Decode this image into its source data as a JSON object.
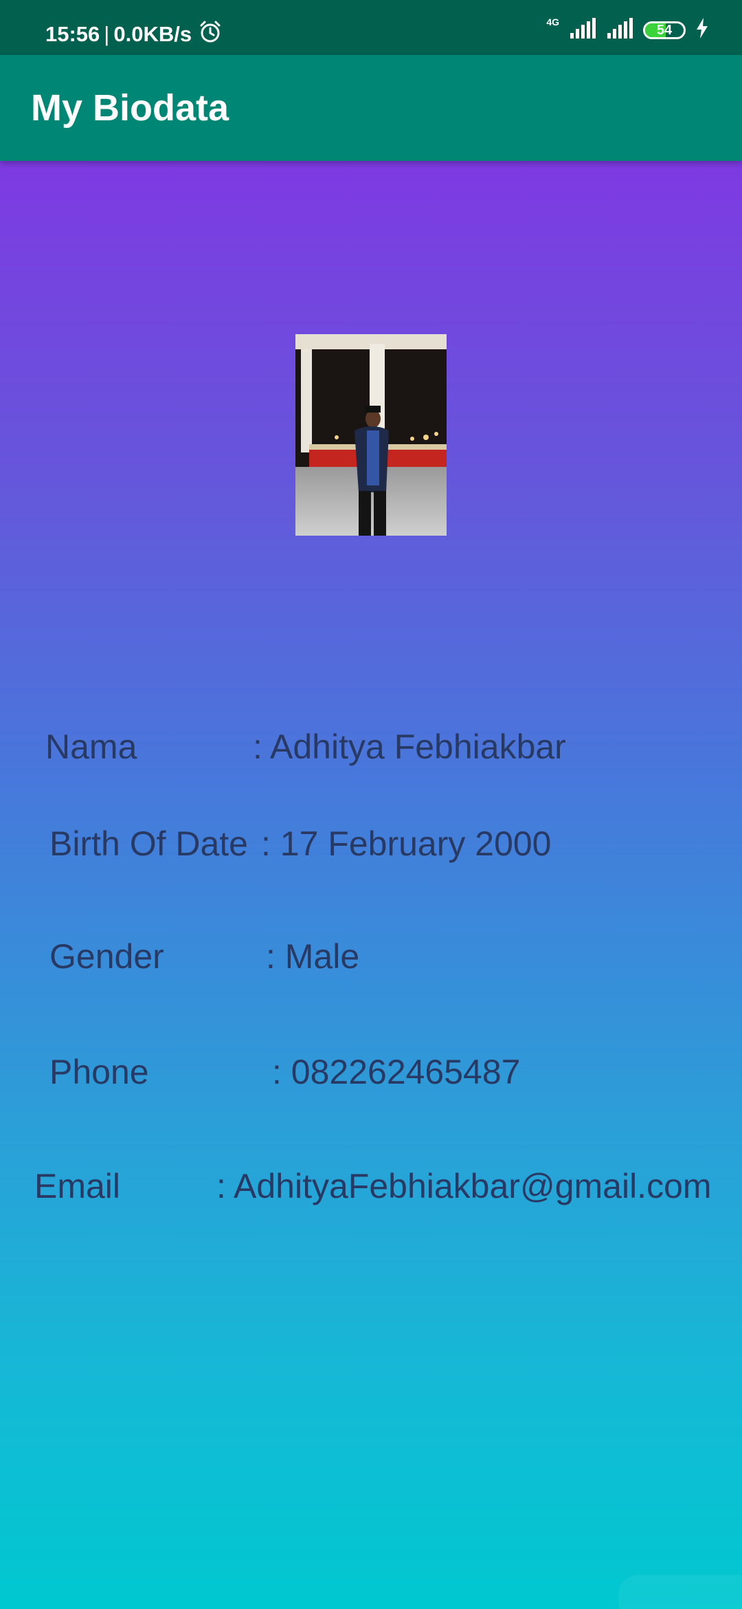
{
  "status_bar": {
    "time": "15:56",
    "separator": "|",
    "speed": "0.0KB/s",
    "network": "4G",
    "battery_level": "54",
    "battery_fraction": 0.54,
    "icons": [
      "alarm-icon",
      "signal-icon",
      "signal-icon",
      "battery-icon",
      "charging-icon"
    ]
  },
  "app_bar": {
    "title": "My Biodata"
  },
  "profile": {
    "photo_icon": "profile-photo"
  },
  "biodata": {
    "nama": {
      "label": "Nama",
      "value": ": Adhitya Febhiakbar"
    },
    "birth": {
      "label": "Birth Of Date",
      "value": ": 17 February 2000"
    },
    "gender": {
      "label": "Gender",
      "value": ": Male"
    },
    "phone": {
      "label": "Phone",
      "value": ": 082262465487"
    },
    "email": {
      "label": "Email",
      "value": ": AdhityaFebhiakbar@gmail.com"
    }
  },
  "colors": {
    "status_bar": "#02604f",
    "app_bar": "#008675",
    "gradient_top": "#8a2be5",
    "gradient_bottom": "#00c8d0",
    "text": "#283a64"
  }
}
